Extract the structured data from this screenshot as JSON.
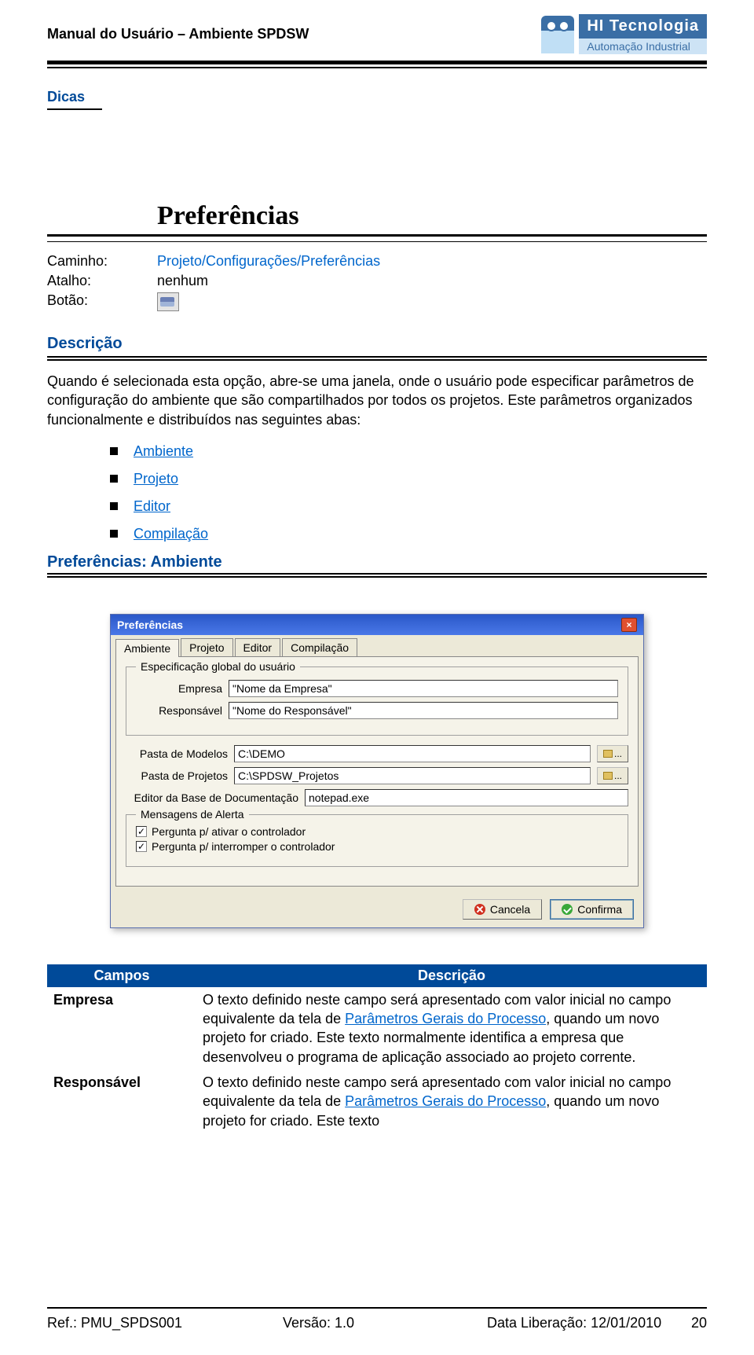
{
  "header": {
    "doc_title": "Manual do Usuário – Ambiente SPDSW",
    "brand_name": "HI Tecnologia",
    "brand_sub": "Automação Industrial"
  },
  "section": {
    "label": "Dicas"
  },
  "pref": {
    "title": "Preferências",
    "caminho_label": "Caminho:",
    "caminho_val": "Projeto/Configurações/Preferências",
    "atalho_label": "Atalho:",
    "atalho_val": "nenhum",
    "botao_label": "Botão:"
  },
  "descricao": {
    "heading": "Descrição",
    "para1": "Quando é selecionada esta opção, abre-se uma janela, onde o usuário pode especificar parâmetros de configuração do ambiente que são compartilhados por todos os projetos. Este parâmetros organizados funcionalmente e distribuídos nas seguintes abas:",
    "items": [
      "Ambiente",
      "Projeto",
      "Editor",
      "Compilação"
    ]
  },
  "subhead": "Preferências: Ambiente",
  "dialog": {
    "title": "Preferências",
    "tabs": [
      "Ambiente",
      "Projeto",
      "Editor",
      "Compilação"
    ],
    "group1": "Especificação global do usuário",
    "empresa_label": "Empresa",
    "empresa_val": "\"Nome da Empresa\"",
    "resp_label": "Responsável",
    "resp_val": "\"Nome do Responsável\"",
    "pasta_modelos_label": "Pasta de Modelos",
    "pasta_modelos_val": "C:\\DEMO",
    "pasta_projetos_label": "Pasta de Projetos",
    "pasta_projetos_val": "C:\\SPDSW_Projetos",
    "editor_base_label": "Editor da Base de Documentação",
    "editor_base_val": "notepad.exe",
    "group2": "Mensagens de Alerta",
    "chk1": "Pergunta p/ ativar o controlador",
    "chk2": "Pergunta p/ interromper o controlador",
    "btn_cancel": "Cancela",
    "btn_ok": "Confirma"
  },
  "table": {
    "h1": "Campos",
    "h2": "Descrição",
    "rows": [
      {
        "field": "Empresa",
        "pre": "O texto definido neste campo será apresentado com valor inicial no campo equivalente da tela de ",
        "link": "Parâmetros Gerais do Processo",
        "post": ", quando um novo projeto for criado. Este texto normalmente identifica a empresa que desenvolveu o programa de aplicação associado ao projeto corrente."
      },
      {
        "field": "Responsável",
        "pre": "O texto definido neste campo será apresentado com valor inicial no campo equivalente da tela de ",
        "link": "Parâmetros Gerais do Processo",
        "post": ", quando um novo projeto for criado. Este texto"
      }
    ]
  },
  "footer": {
    "ref": "Ref.: PMU_SPDS001",
    "version": "Versão: 1.0",
    "date": "Data Liberação: 12/01/2010",
    "page": "20"
  }
}
